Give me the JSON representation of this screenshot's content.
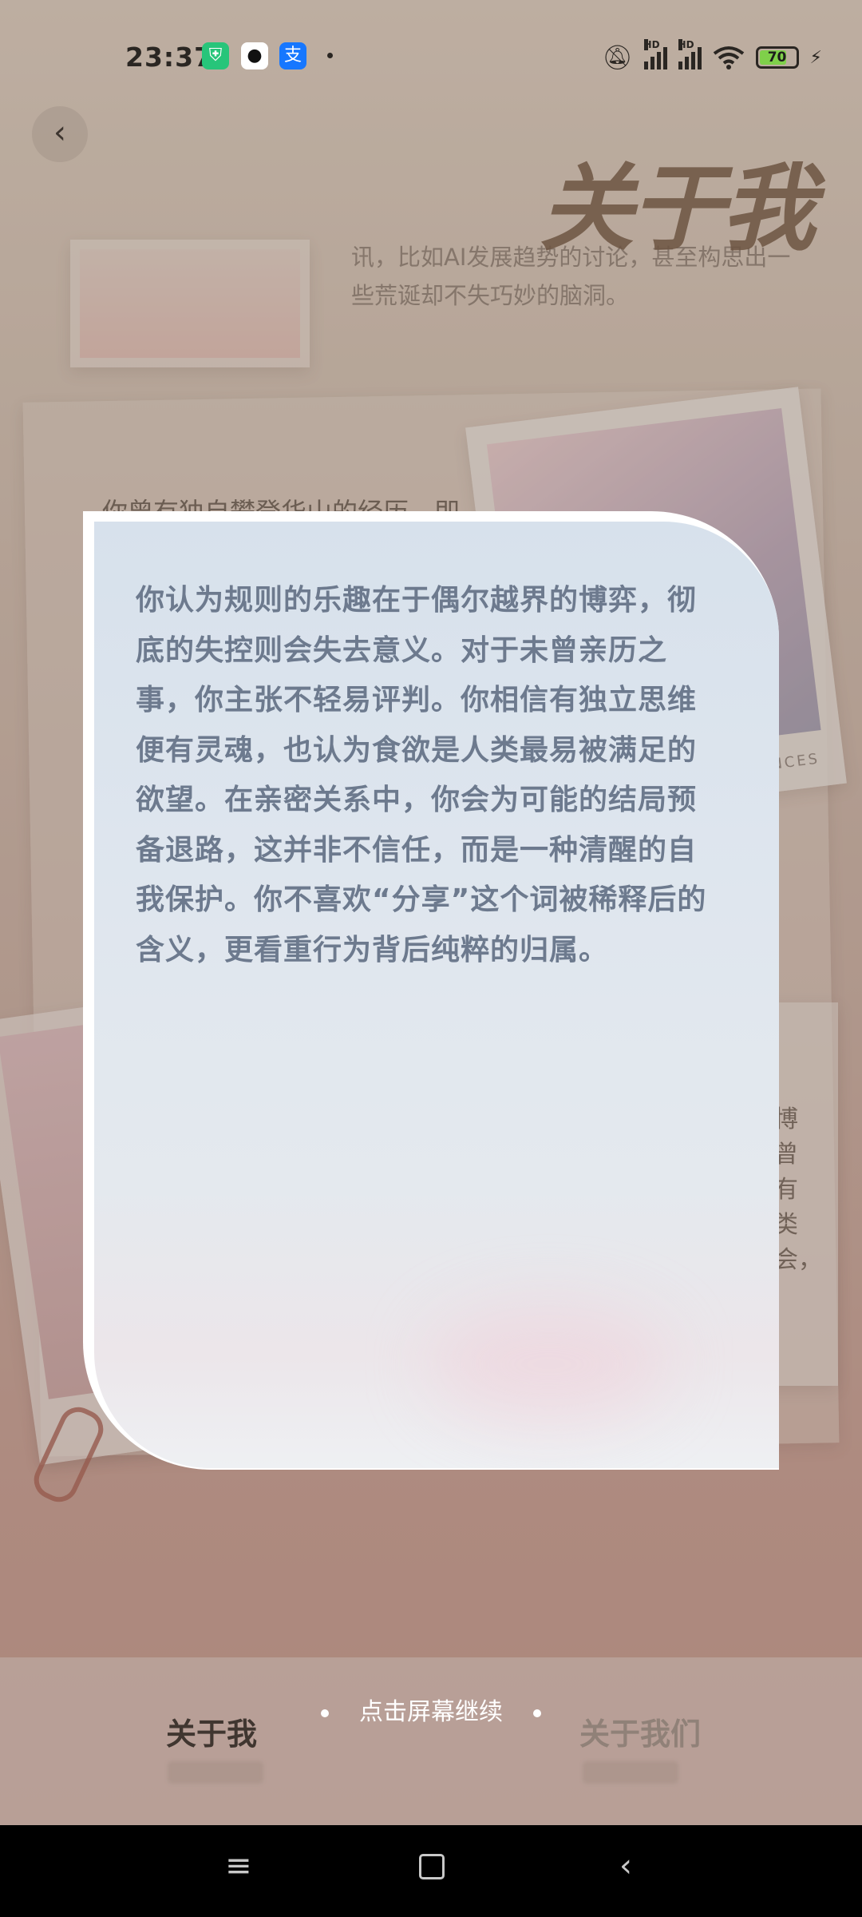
{
  "status_bar": {
    "time": "23:37",
    "battery": "70",
    "hd1": "HD",
    "hd2": "HD",
    "apps": [
      "shield-app-icon",
      "qq-icon",
      "alipay-icon"
    ],
    "alipay_glyph": "支"
  },
  "header": {
    "back_icon": "‹",
    "title": "关于我"
  },
  "background": {
    "snippet_top": "讯，比如AI发展趋势的讨论，甚至构思出一些荒诞却不失巧妙的脑洞。",
    "snippet_mid": "你曾有独自攀登华山的经历，即",
    "photo_caption": "RIENCES",
    "side_text": "博曾有类会，"
  },
  "modal": {
    "text": "你认为规则的乐趣在于偶尔越界的博弈，彻底的失控则会失去意义。对于未曾亲历之事，你主张不轻易评判。你相信有独立思维便有灵魂，也认为食欲是人类最易被满足的欲望。在亲密关系中，你会为可能的结局预备退路，这并非不信任，而是一种清醒的自我保护。你不喜欢“分享”这个词被稀释后的含义，更看重行为背后纯粹的归属。"
  },
  "tabs": {
    "me": "关于我",
    "us": "关于我们"
  },
  "hint": "点击屏幕继续",
  "nav": {
    "menu": "≡",
    "back": "‹"
  },
  "colors": {
    "modal_text": "#6d7a8e",
    "accent_title": "#6a4f3a"
  }
}
